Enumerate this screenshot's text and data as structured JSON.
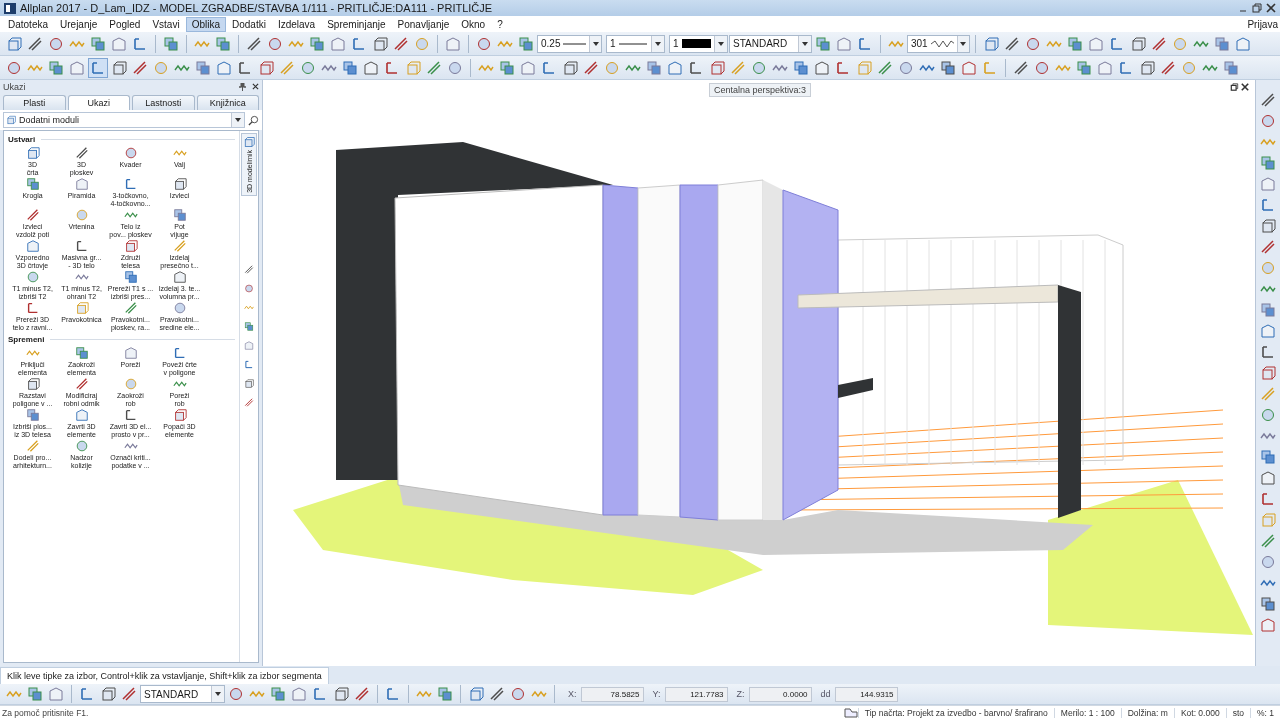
{
  "window": {
    "title": "Allplan 2017 - D_Lam_IDZ - MODEL ZGRADBE/STAVBA 1/111 - PRITLIČJE:DA111 - PRITLIČJE"
  },
  "menu": [
    {
      "label": "Datoteka",
      "selected": false
    },
    {
      "label": "Urejanje",
      "selected": false
    },
    {
      "label": "Pogled",
      "selected": false
    },
    {
      "label": "Vstavi",
      "selected": false
    },
    {
      "label": "Oblika",
      "selected": true
    },
    {
      "label": "Dodatki",
      "selected": false
    },
    {
      "label": "Izdelava",
      "selected": false
    },
    {
      "label": "Spreminjanje",
      "selected": false
    },
    {
      "label": "Ponavljanje",
      "selected": false
    },
    {
      "label": "Okno",
      "selected": false
    },
    {
      "label": "?",
      "selected": false
    }
  ],
  "login": "Prijava",
  "format": {
    "pen": "0.25",
    "line": "1",
    "color_number": "1",
    "style": "STANDARD",
    "hatch": "301"
  },
  "tooltip": "Centalna perspektiva:3",
  "panel": {
    "title": "Ukazi",
    "tabs": [
      {
        "label": "Plasti",
        "selected": false
      },
      {
        "label": "Ukazi",
        "selected": true
      },
      {
        "label": "Lastnosti",
        "selected": false
      },
      {
        "label": "Knjižnica",
        "selected": false
      }
    ],
    "module": "Dodatni moduli",
    "side_tab": "3D modelirnik",
    "sections": [
      {
        "title": "Ustvari",
        "items": [
          "3D\nčrta",
          "3D\nploskev",
          "Kvader",
          "Valj",
          "Krogla",
          "Piramida",
          "3-točkovno,\n4-točkovno...",
          "Izvleci",
          "Izvleci\nvzdolž poti",
          "Vrtenina",
          "Telo iz\npov... ploskev",
          "Pot\nvijuge",
          "Vzporedno\n3D črtovje",
          "Masivna gr...\n- 3D telo",
          "Združi\ntelesa",
          "Izdelaj\npresečno t...",
          "T1 minus T2,\nizbriši T2",
          "T1 minus T2,\nohrani T2",
          "Prereži T1 s ...\nizbriši pres...",
          "Izdelaj 3. te...\nvolumna pr...",
          "Prereži 3D\ntelo z ravni...",
          "Pravokotnica",
          "Pravokotni...\nploskev, ra...",
          "Pravokotni...\nsredine ele..."
        ]
      },
      {
        "title": "Spremeni",
        "items": [
          "Priključi\nelementa",
          "Zaokroži\nelementa",
          "Poreži",
          "Poveži črte\nv poligone",
          "Razstavi\npoligone v ...",
          "Modificiraj\nrobni odmik",
          "Zaokroži\nrob",
          "Poreži\nrob",
          "Izbriši plos...\niz 3D telesa",
          "Zavrti 3D\nelemente",
          "Zavrti 3D el...\nprosto v pr...",
          "Popači 3D\nelemente",
          "Dodeli pro...\narhitekturn...",
          "Nadzor\nkolizije",
          "Označi kriti...\npodatke v ..."
        ]
      }
    ]
  },
  "prompt": "Klik leve tipke za izbor, Control+klik za vstavljanje, Shift+klik za izbor segmenta",
  "bottom": {
    "style": "STANDARD",
    "coords": [
      {
        "label": "X:",
        "value": "78.5825"
      },
      {
        "label": "Y:",
        "value": "121.7783"
      },
      {
        "label": "Z:",
        "value": "0.0000"
      },
      {
        "label": "dd",
        "value": "144.9315"
      }
    ]
  },
  "status": {
    "help": "Za pomoč pritisnite F1.",
    "fields": [
      {
        "label": "Tip načrta:",
        "value": "Projekt za izvedbo - barvno/ šrafirano"
      },
      {
        "label": "Merilo:",
        "value": "1 : 100"
      },
      {
        "label": "Dolžina:",
        "value": "m"
      },
      {
        "label": "Kot:",
        "value": "0.000"
      },
      {
        "value": "sto"
      },
      {
        "label": "%:",
        "value": "1"
      }
    ]
  }
}
